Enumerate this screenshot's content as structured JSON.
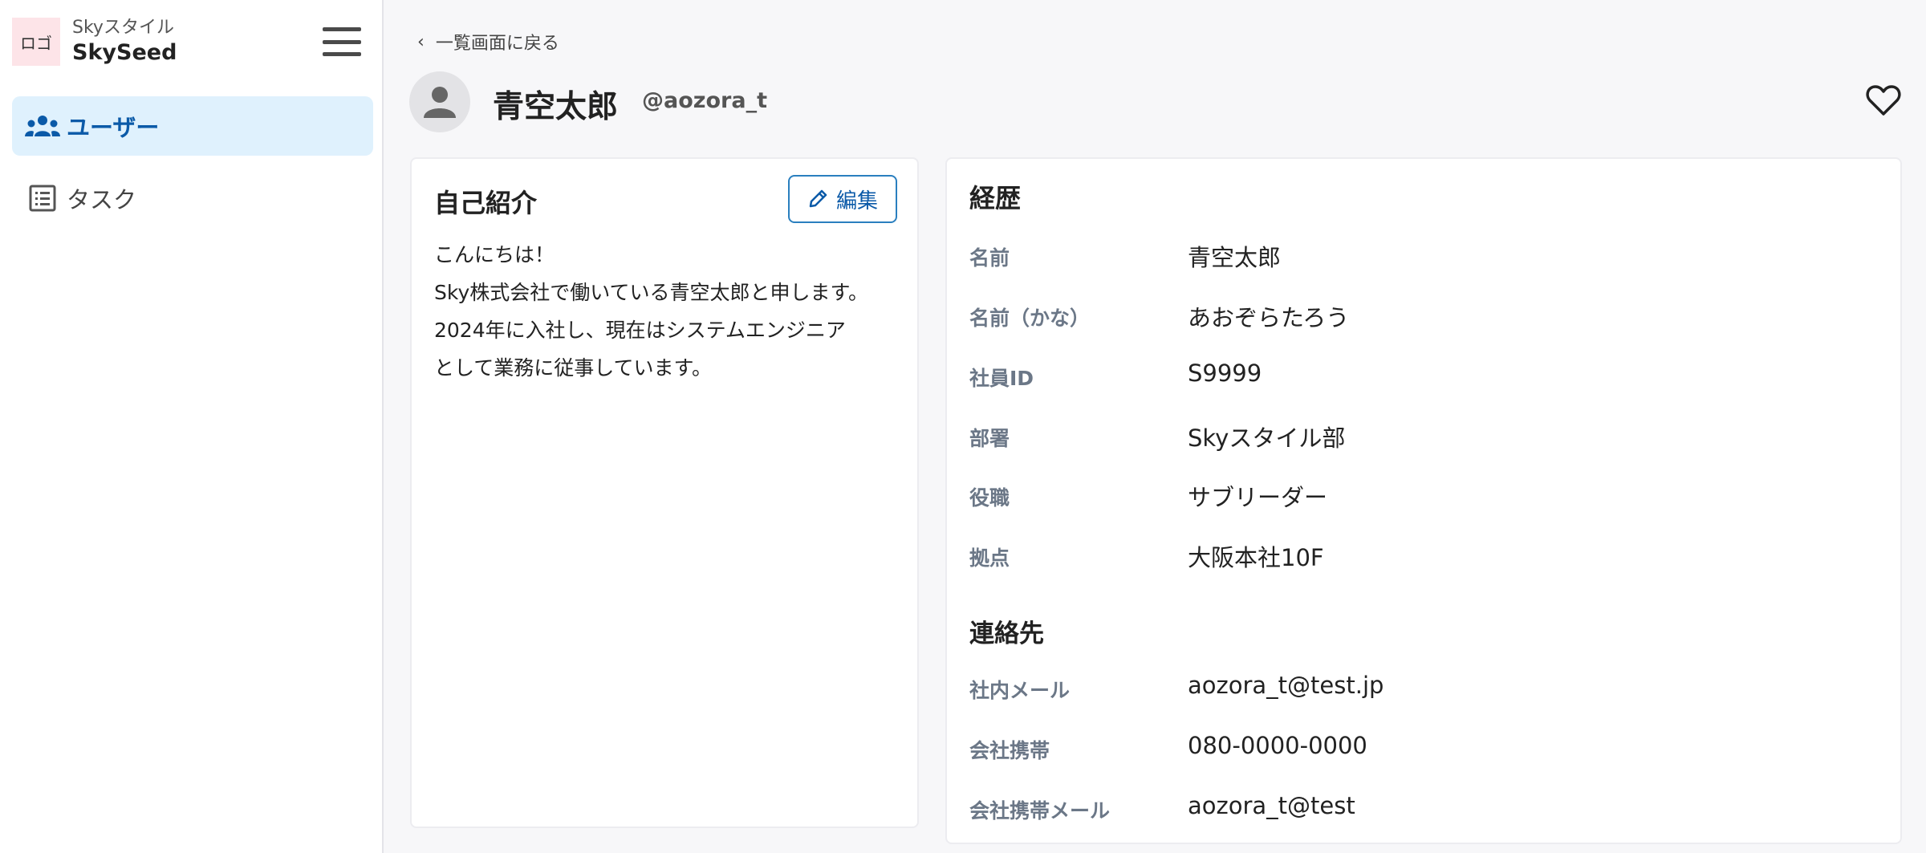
{
  "sidebar": {
    "logo_text": "ロゴ",
    "brand_sub": "Skyスタイル",
    "brand_name": "SkySeed",
    "menu_icon": "hamburger-icon",
    "items": [
      {
        "label": "ユーザー",
        "icon": "users-icon",
        "active": true
      },
      {
        "label": "タスク",
        "icon": "list-icon",
        "active": false
      }
    ]
  },
  "header": {
    "back_label": "一覧画面に戻る",
    "user_name": "青空太郎",
    "user_handle": "@aozora_t",
    "favorite_icon": "heart-icon"
  },
  "intro": {
    "title": "自己紹介",
    "edit_label": "編集",
    "lines": [
      "こんにちは！",
      "Sky株式会社で働いている青空太郎と申します。",
      "2024年に入社し、現在はシステムエンジニア",
      "として業務に従事しています。"
    ]
  },
  "career": {
    "title": "経歴",
    "fields": [
      {
        "label": "名前",
        "value": "青空太郎"
      },
      {
        "label": "名前（かな）",
        "value": "あおぞらたろう"
      },
      {
        "label": "社員ID",
        "value": "S9999"
      },
      {
        "label": "部署",
        "value": "Skyスタイル部"
      },
      {
        "label": "役職",
        "value": "サブリーダー"
      },
      {
        "label": "拠点",
        "value": "大阪本社10F"
      }
    ],
    "contact_title": "連絡先",
    "contact_fields": [
      {
        "label": "社内メール",
        "value": "aozora_t@test.jp"
      },
      {
        "label": "会社携帯",
        "value": "080-0000-0000"
      },
      {
        "label": "会社携帯メール",
        "value": "aozora_t@test"
      }
    ]
  },
  "colors": {
    "accent": "#0b5aa8",
    "active_bg": "#dff1fd",
    "label_gray": "#6b7787"
  }
}
